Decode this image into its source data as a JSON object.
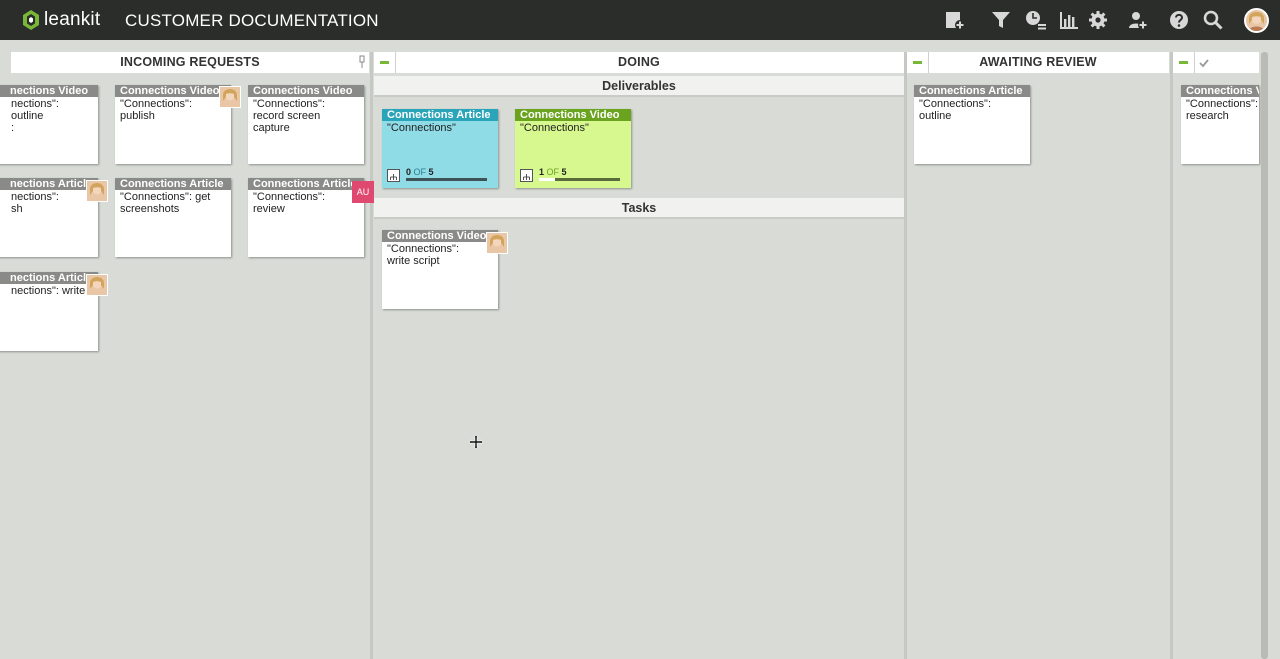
{
  "app": {
    "logo_text": "leankit",
    "board_title": "CUSTOMER DOCUMENTATION"
  },
  "toolbar": {
    "icons": [
      "add-card-icon",
      "filter-icon",
      "activity-icon",
      "reports-icon",
      "settings-icon",
      "add-user-icon",
      "help-icon",
      "search-icon",
      "user-avatar"
    ]
  },
  "lanes": {
    "incoming": {
      "title": "INCOMING REQUESTS"
    },
    "doing": {
      "title": "DOING",
      "sub": [
        "Deliverables",
        "Tasks"
      ]
    },
    "review": {
      "title": "AWAITING REVIEW"
    },
    "done": {
      "title": ""
    }
  },
  "cards": {
    "inc1": {
      "type": "nections Video",
      "title": "nections\": outline\n:"
    },
    "inc2": {
      "type": "Connections Video",
      "title": "\"Connections\": publish"
    },
    "inc3": {
      "type": "Connections Video",
      "title": "\"Connections\": record screen capture"
    },
    "inc4": {
      "type": "nections Article",
      "title": "nections\":\nsh"
    },
    "inc5": {
      "type": "Connections Article",
      "title": "\"Connections\": get screenshots"
    },
    "inc6": {
      "type": "Connections Article",
      "title": "\"Connections\": review",
      "badge": "AU"
    },
    "inc7": {
      "type": "nections Article",
      "title": "nections\": write"
    },
    "del1": {
      "type": "Connections Article",
      "title": "\"Connections\"",
      "progress_done": "0",
      "progress_of": "OF",
      "progress_total": "5",
      "progress_fraction": 0
    },
    "del2": {
      "type": "Connections Video",
      "title": "\"Connections\"",
      "progress_done": "1",
      "progress_of": "OF",
      "progress_total": "5",
      "progress_fraction": 0.2
    },
    "task1": {
      "type": "Connections Video",
      "title": "\"Connections\": write script"
    },
    "rev1": {
      "type": "Connections Article",
      "title": "\"Connections\": outline"
    },
    "done1": {
      "type": "Connections Vi",
      "title": "\"Connections\": research"
    }
  },
  "colors": {
    "topbar": "#2b2d2a",
    "accent_green": "#79b837",
    "article_cyan": "#2aa4b8",
    "video_lime": "#6aa41f",
    "badge_pink": "#e0496f"
  }
}
